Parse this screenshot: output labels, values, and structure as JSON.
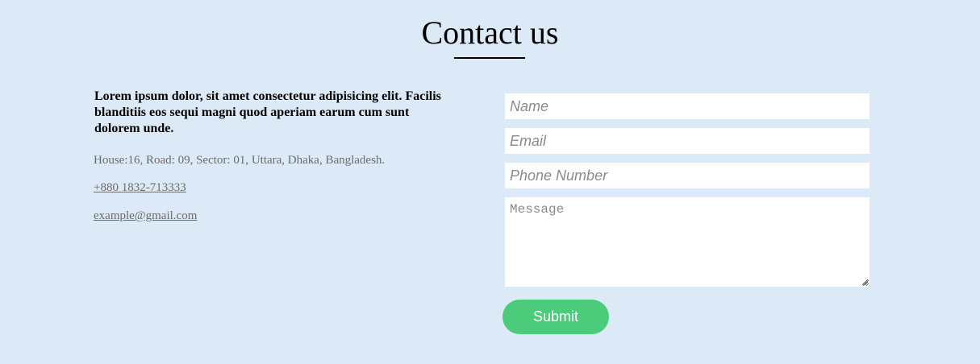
{
  "header": {
    "title": "Contact us"
  },
  "info": {
    "intro": "Lorem ipsum dolor, sit amet consectetur adipisicing elit. Facilis blanditiis eos sequi magni quod aperiam earum cum sunt dolorem unde.",
    "address": "House:16, Road: 09, Sector: 01, Uttara, Dhaka, Bangladesh.",
    "phone": "+880 1832-713333",
    "email": "example@gmail.com"
  },
  "form": {
    "name_placeholder": "Name",
    "name_value": "",
    "email_placeholder": "Email",
    "email_value": "",
    "phone_placeholder": "Phone Number",
    "phone_value": "",
    "message_placeholder": "Message",
    "message_value": "",
    "submit_label": "Submit"
  },
  "colors": {
    "background": "#dbeaf6",
    "submit_button": "#4ccc7a",
    "muted_text": "#6b6b6b"
  }
}
